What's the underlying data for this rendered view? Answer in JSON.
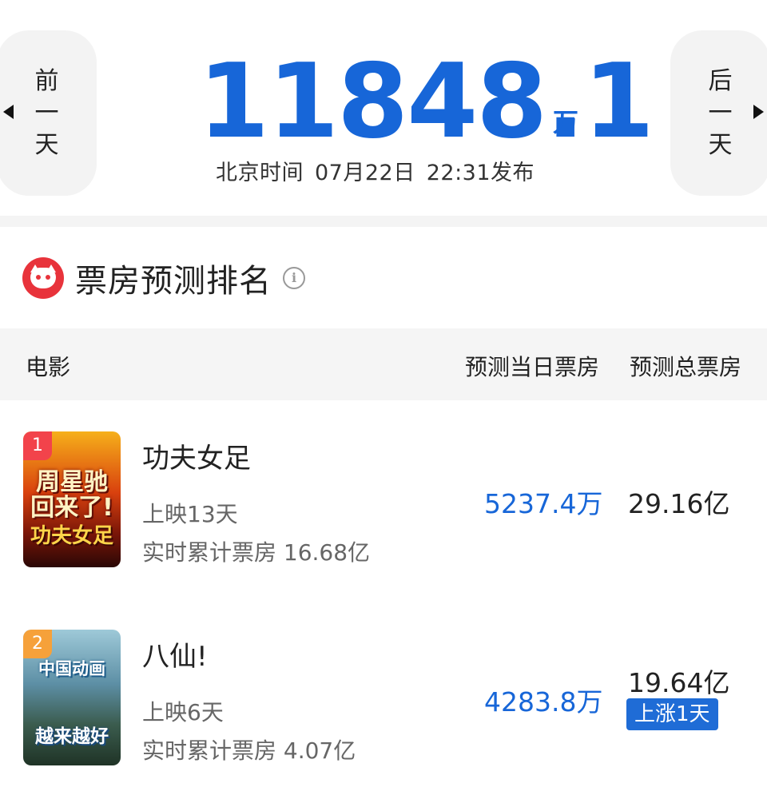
{
  "nav": {
    "prev_label": "前一天",
    "next_label": "后一天"
  },
  "summary": {
    "total_value": "11848.1",
    "total_unit": "万",
    "publish_prefix": "北京时间",
    "publish_date": "07月22日",
    "publish_time": "22:31发布"
  },
  "ranking": {
    "title": "票房预测排名",
    "info_icon": "info-icon",
    "logo_icon": "maoyan-cat-icon",
    "columns": {
      "movie": "电影",
      "day_forecast": "预测当日票房",
      "total_forecast": "预测总票房"
    },
    "movies": [
      {
        "rank": "1",
        "name": "功夫女足",
        "poster_line1": "周星驰\n回来了!",
        "poster_line2": "功夫女足",
        "days": "上映13天",
        "cumulative": "实时累计票房 16.68亿",
        "day_forecast": "5237.4万",
        "total_forecast": "29.16亿"
      },
      {
        "rank": "2",
        "name": "八仙!",
        "poster_line1": "中国动画",
        "poster_line2": "越来越好",
        "days": "上映6天",
        "cumulative": "实时累计票房 4.07亿",
        "day_forecast": "4283.8万",
        "total_forecast": "19.64亿",
        "badge": "上涨1天"
      }
    ]
  },
  "colors": {
    "accent_blue": "#1766d8",
    "badge_blue": "#1f6cd6",
    "rank1": "#f2434b",
    "rank2": "#f6a13a",
    "logo_red": "#e8333b"
  }
}
